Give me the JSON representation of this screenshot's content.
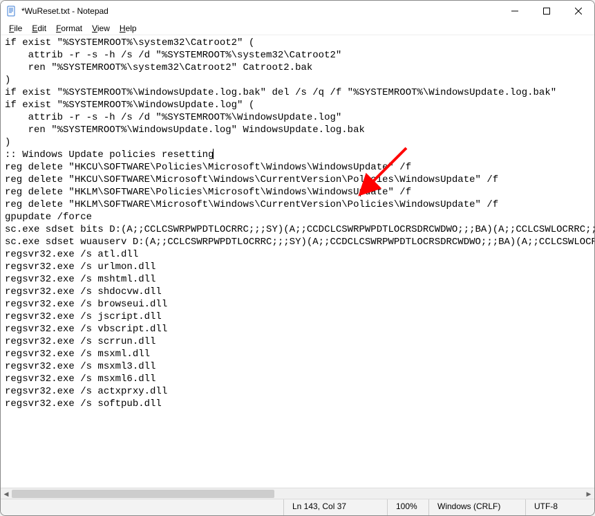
{
  "window": {
    "title": "*WuReset.txt - Notepad"
  },
  "menu": {
    "file": "File",
    "edit": "Edit",
    "format": "Format",
    "view": "View",
    "help": "Help"
  },
  "annotation": {
    "type": "arrow",
    "color": "#ff0000"
  },
  "content": {
    "lines": [
      "if exist \"%SYSTEMROOT%\\system32\\Catroot2\" (",
      "    attrib -r -s -h /s /d \"%SYSTEMROOT%\\system32\\Catroot2\"",
      "    ren \"%SYSTEMROOT%\\system32\\Catroot2\" Catroot2.bak",
      ")",
      "",
      "if exist \"%SYSTEMROOT%\\WindowsUpdate.log.bak\" del /s /q /f \"%SYSTEMROOT%\\WindowsUpdate.log.bak\"",
      "if exist \"%SYSTEMROOT%\\WindowsUpdate.log\" (",
      "    attrib -r -s -h /s /d \"%SYSTEMROOT%\\WindowsUpdate.log\"",
      "    ren \"%SYSTEMROOT%\\WindowsUpdate.log\" WindowsUpdate.log.bak",
      ")",
      "",
      "",
      ":: Windows Update policies resetting",
      "reg delete \"HKCU\\SOFTWARE\\Policies\\Microsoft\\Windows\\WindowsUpdate\" /f",
      "reg delete \"HKCU\\SOFTWARE\\Microsoft\\Windows\\CurrentVersion\\Policies\\WindowsUpdate\" /f",
      "reg delete \"HKLM\\SOFTWARE\\Policies\\Microsoft\\Windows\\WindowsUpdate\" /f",
      "reg delete \"HKLM\\SOFTWARE\\Microsoft\\Windows\\CurrentVersion\\Policies\\WindowsUpdate\" /f",
      "gpupdate /force",
      "",
      "",
      "sc.exe sdset bits D:(A;;CCLCSWRPWPDTLOCRRC;;;SY)(A;;CCDCLCSWRPWPDTLOCRSDRCWDWO;;;BA)(A;;CCLCSWLOCRRC;;;AU",
      "sc.exe sdset wuauserv D:(A;;CCLCSWRPWPDTLOCRRC;;;SY)(A;;CCDCLCSWRPWPDTLOCRSDRCWDWO;;;BA)(A;;CCLCSWLOCRRC",
      "",
      "regsvr32.exe /s atl.dll",
      "regsvr32.exe /s urlmon.dll",
      "regsvr32.exe /s mshtml.dll",
      "regsvr32.exe /s shdocvw.dll",
      "regsvr32.exe /s browseui.dll",
      "regsvr32.exe /s jscript.dll",
      "regsvr32.exe /s vbscript.dll",
      "regsvr32.exe /s scrrun.dll",
      "regsvr32.exe /s msxml.dll",
      "regsvr32.exe /s msxml3.dll",
      "regsvr32.exe /s msxml6.dll",
      "regsvr32.exe /s actxprxy.dll",
      "regsvr32.exe /s softpub.dll"
    ],
    "caret_line_index": 12
  },
  "status": {
    "lncol": "Ln 143, Col 37",
    "zoom": "100%",
    "eol": "Windows (CRLF)",
    "encoding": "UTF-8"
  }
}
